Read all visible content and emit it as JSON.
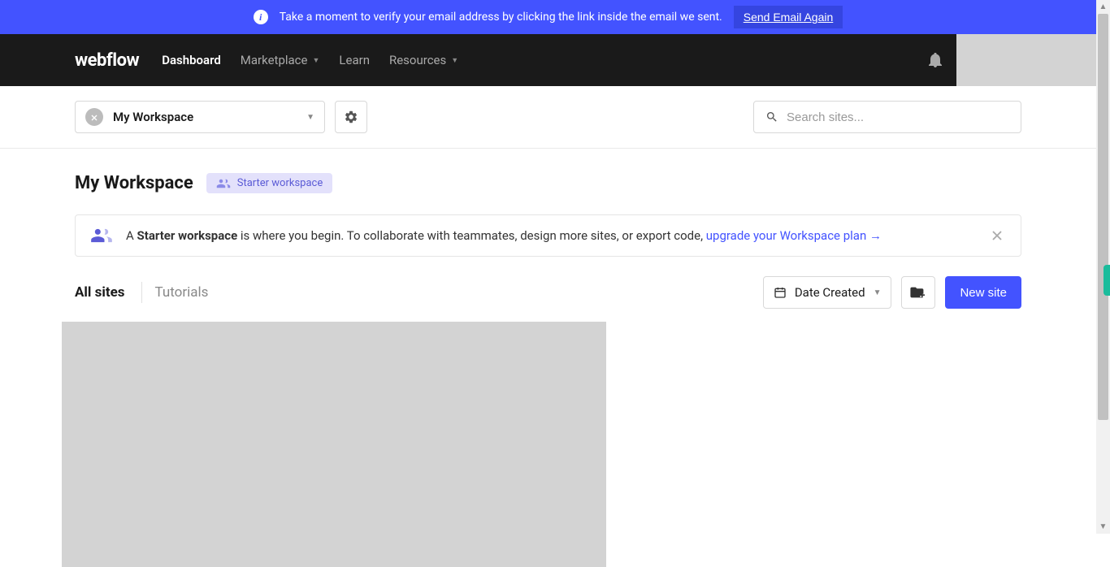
{
  "banner": {
    "text": "Take a moment to verify your email address by clicking the link inside the email we sent.",
    "button": "Send Email Again"
  },
  "nav": {
    "logo": "webflow",
    "links": [
      {
        "label": "Dashboard",
        "has_dropdown": false,
        "active": true
      },
      {
        "label": "Marketplace",
        "has_dropdown": true,
        "active": false
      },
      {
        "label": "Learn",
        "has_dropdown": false,
        "active": false
      },
      {
        "label": "Resources",
        "has_dropdown": true,
        "active": false
      }
    ]
  },
  "toolbar": {
    "workspace_name": "My Workspace",
    "search_placeholder": "Search sites..."
  },
  "main": {
    "title": "My Workspace",
    "badge": "Starter workspace",
    "info_prefix": "A ",
    "info_bold": "Starter workspace",
    "info_mid": " is where you begin. To collaborate with teammates, design more sites, or export code, ",
    "info_link": "upgrade your Workspace plan",
    "tabs": {
      "all": "All sites",
      "tutorials": "Tutorials"
    },
    "sort_label": "Date Created",
    "new_site": "New site"
  }
}
